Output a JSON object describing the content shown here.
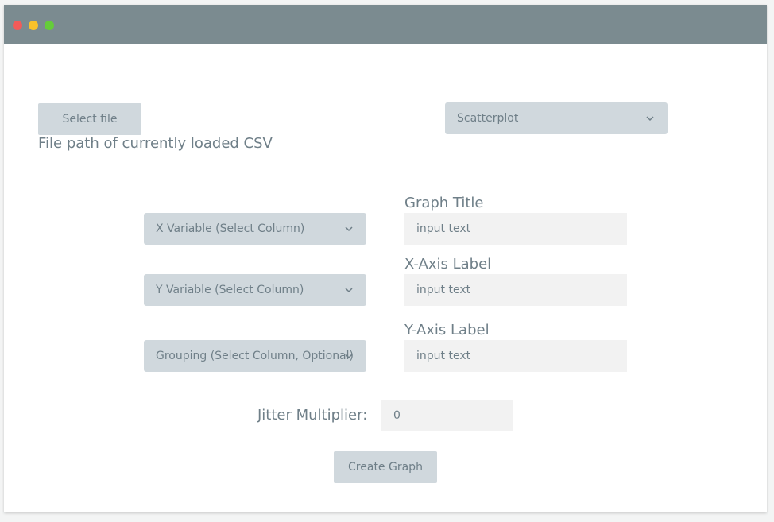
{
  "window": {
    "controls": [
      {
        "name": "close",
        "color": "#f25b59"
      },
      {
        "name": "minimize",
        "color": "#f9c22b"
      },
      {
        "name": "maximize",
        "color": "#65cc3a"
      }
    ]
  },
  "file": {
    "select_button": "Select file",
    "path_label": "File path of currently loaded CSV"
  },
  "plot_type": {
    "selected": "Scatterplot"
  },
  "variables": {
    "x": "X Variable (Select Column)",
    "y": "Y Variable (Select Column)",
    "grouping": "Grouping (Select Column, Optional)"
  },
  "labels": {
    "graph_title": {
      "heading": "Graph Title",
      "value": "input text"
    },
    "x_axis": {
      "heading": "X-Axis Label",
      "value": "input text"
    },
    "y_axis": {
      "heading": "Y-Axis Label",
      "value": "input text"
    }
  },
  "jitter": {
    "label": "Jitter Multiplier:",
    "value": "0"
  },
  "create_button": "Create Graph",
  "colors": {
    "titlebar": "#7b8b90",
    "control_bg": "#d0d8dd",
    "input_bg": "#f2f2f2",
    "text": "#6f7f88"
  }
}
